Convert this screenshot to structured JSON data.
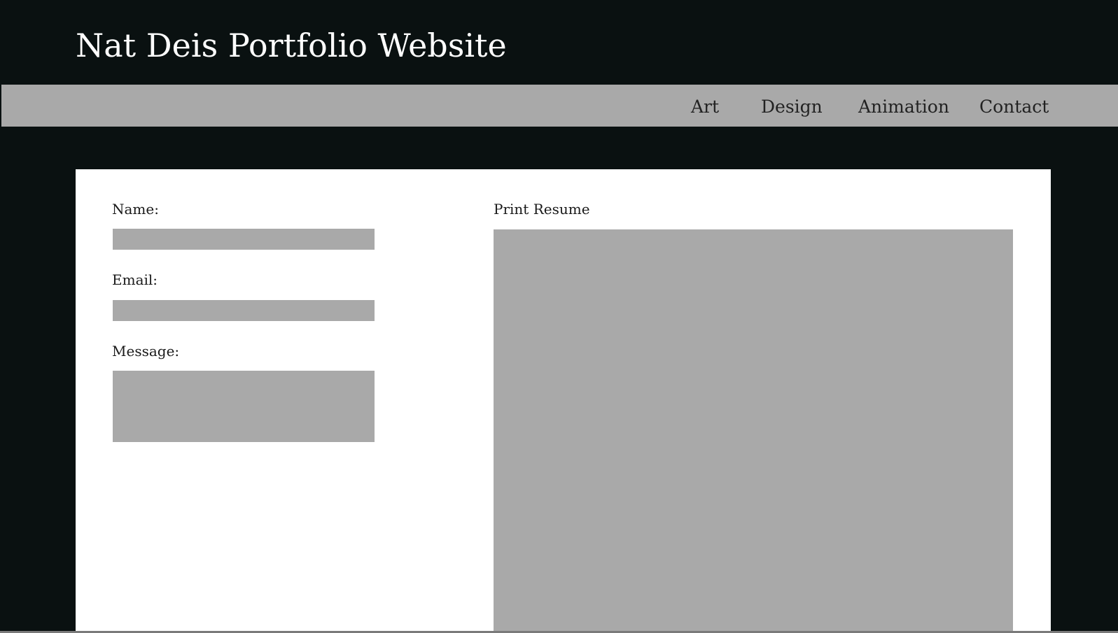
{
  "header": {
    "title": "Nat Deis Portfolio Website"
  },
  "nav": {
    "items": [
      {
        "label": "Art"
      },
      {
        "label": "Design"
      },
      {
        "label": "Animation"
      },
      {
        "label": "Contact"
      }
    ]
  },
  "contact_form": {
    "name_label": "Name:",
    "name_value": "",
    "email_label": "Email:",
    "email_value": "",
    "message_label": "Message:",
    "message_value": ""
  },
  "resume": {
    "label": "Print Resume"
  },
  "colors": {
    "background": "#0a1111",
    "nav_bar": "#a9a9a9",
    "content_panel": "#ffffff",
    "placeholder_gray": "#a9a9a9",
    "title_text": "#ffffff"
  }
}
